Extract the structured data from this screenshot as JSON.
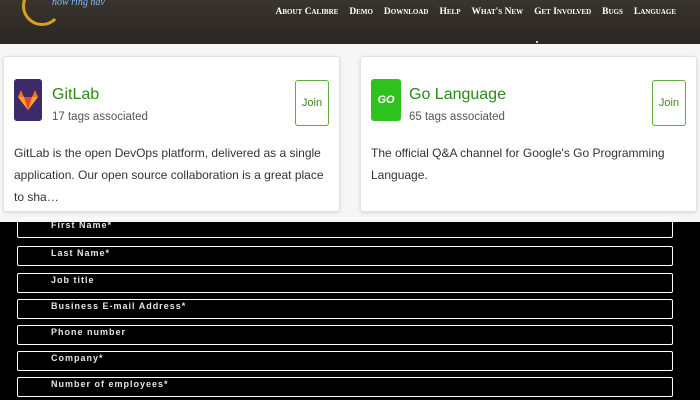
{
  "header": {
    "logo_text": "now ring nav",
    "nav": [
      "About Calibre",
      "Demo",
      "Download",
      "Help",
      "What's New",
      "Get Involved",
      "Bugs",
      "Language"
    ]
  },
  "cards": [
    {
      "title": "GitLab",
      "tags": "17 tags associated",
      "description": "GitLab is the open DevOps platform, delivered as a single application. Our open source collaboration is a great place to sha…",
      "join": "Join",
      "icon": "gitlab-icon",
      "accent": "#3d2a6b"
    },
    {
      "title": "Go Language",
      "tags": "65 tags associated",
      "description": "The official Q&A channel for Google's Go Programming Language.",
      "join": "Join",
      "icon": "go-icon",
      "icon_text": "GO",
      "accent": "#2ec21e"
    }
  ],
  "form": {
    "fields": [
      "First Name*",
      "Last Name*",
      "Job title",
      "Business E-mail Address*",
      "Phone number",
      "Company*",
      "Number of employees*"
    ]
  },
  "colors": {
    "title_green": "#2a8a14",
    "join_border": "#5cad3a"
  }
}
